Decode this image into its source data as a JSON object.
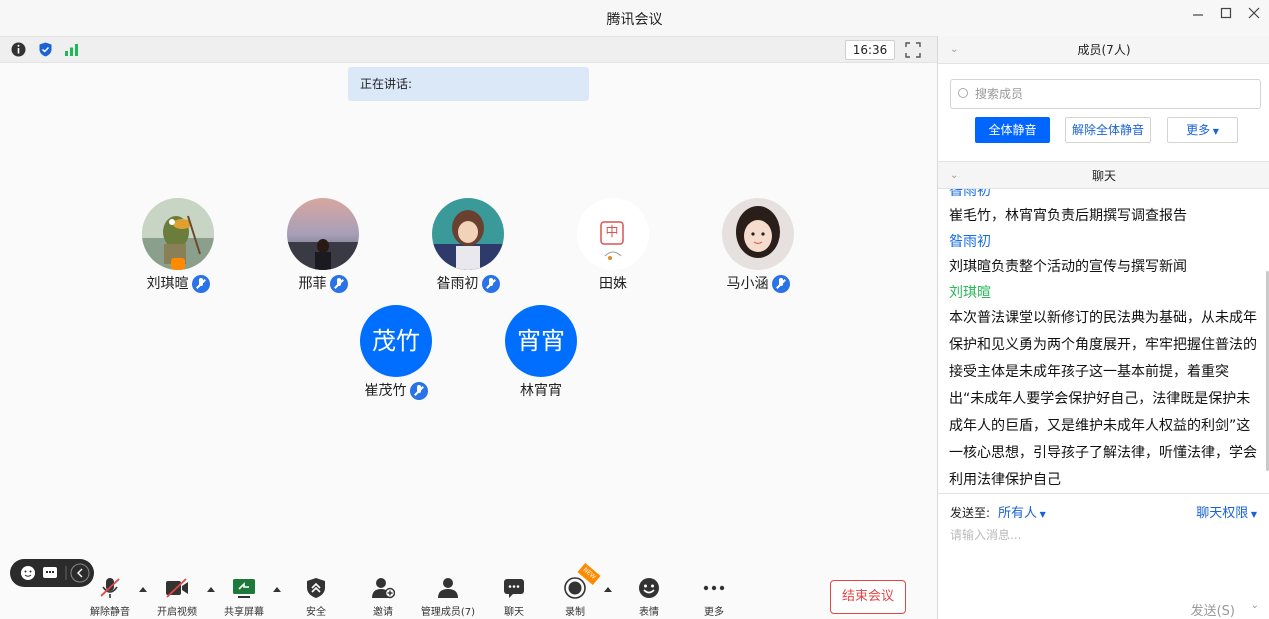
{
  "window": {
    "title": "腾讯会议"
  },
  "topbar": {
    "time": "16:36"
  },
  "speaking_label": "正在讲话:",
  "members": [
    {
      "name": "刘琪暄",
      "muted": true
    },
    {
      "name": "邢菲",
      "muted": true
    },
    {
      "name": "昝雨初",
      "muted": true
    },
    {
      "name": "田姝",
      "muted": false
    },
    {
      "name": "马小涵",
      "muted": true
    },
    {
      "name": "崔茂竹",
      "avatar_text": "茂竹",
      "muted": true
    },
    {
      "name": "林宵宵",
      "avatar_text": "宵宵",
      "muted": false
    }
  ],
  "avatar_sticker_text": "中",
  "toolbar": {
    "unmute": "解除静音",
    "video": "开启视频",
    "share": "共享屏幕",
    "security": "安全",
    "invite": "邀请",
    "manage": "管理成员(7)",
    "chat": "聊天",
    "record": "录制",
    "emoji": "表情",
    "more": "更多",
    "end": "结束会议",
    "new_badge": "NEW"
  },
  "panel": {
    "members_title": "成员(7人)",
    "search_placeholder": "搜索成员",
    "mute_all": "全体静音",
    "unmute_all": "解除全体静音",
    "more": "更多",
    "chat_title": "聊天"
  },
  "chat": {
    "messages": [
      {
        "sender": "昝雨初",
        "text": "崔毛竹，林宵宵负责后期撰写调查报告"
      },
      {
        "sender": "昝雨初",
        "text": "刘琪暄负责整个活动的宣传与撰写新闻"
      },
      {
        "sender": "刘琪暄",
        "text": "本次普法课堂以新修订的民法典为基础，从未成年保护和见义勇为两个角度展开，牢牢把握住普法的接受主体是未成年孩子这一基本前提，着重突出“未成年人要学会保护好自己，法律既是保护未成年人的巨盾，又是维护未成年人权益的利剑”这一核心思想，引导孩子了解法律，听懂法律，学会利用法律保护自己"
      }
    ],
    "send_to_label": "发送至:",
    "send_to_value": "所有人",
    "permission": "聊天权限",
    "input_placeholder": "请输入消息...",
    "send_button": "发送(S)"
  },
  "colors": {
    "accent": "#0066ff",
    "danger": "#e54545",
    "sender_blue": "#1a6fe0",
    "sender_green": "#2bb85c"
  }
}
